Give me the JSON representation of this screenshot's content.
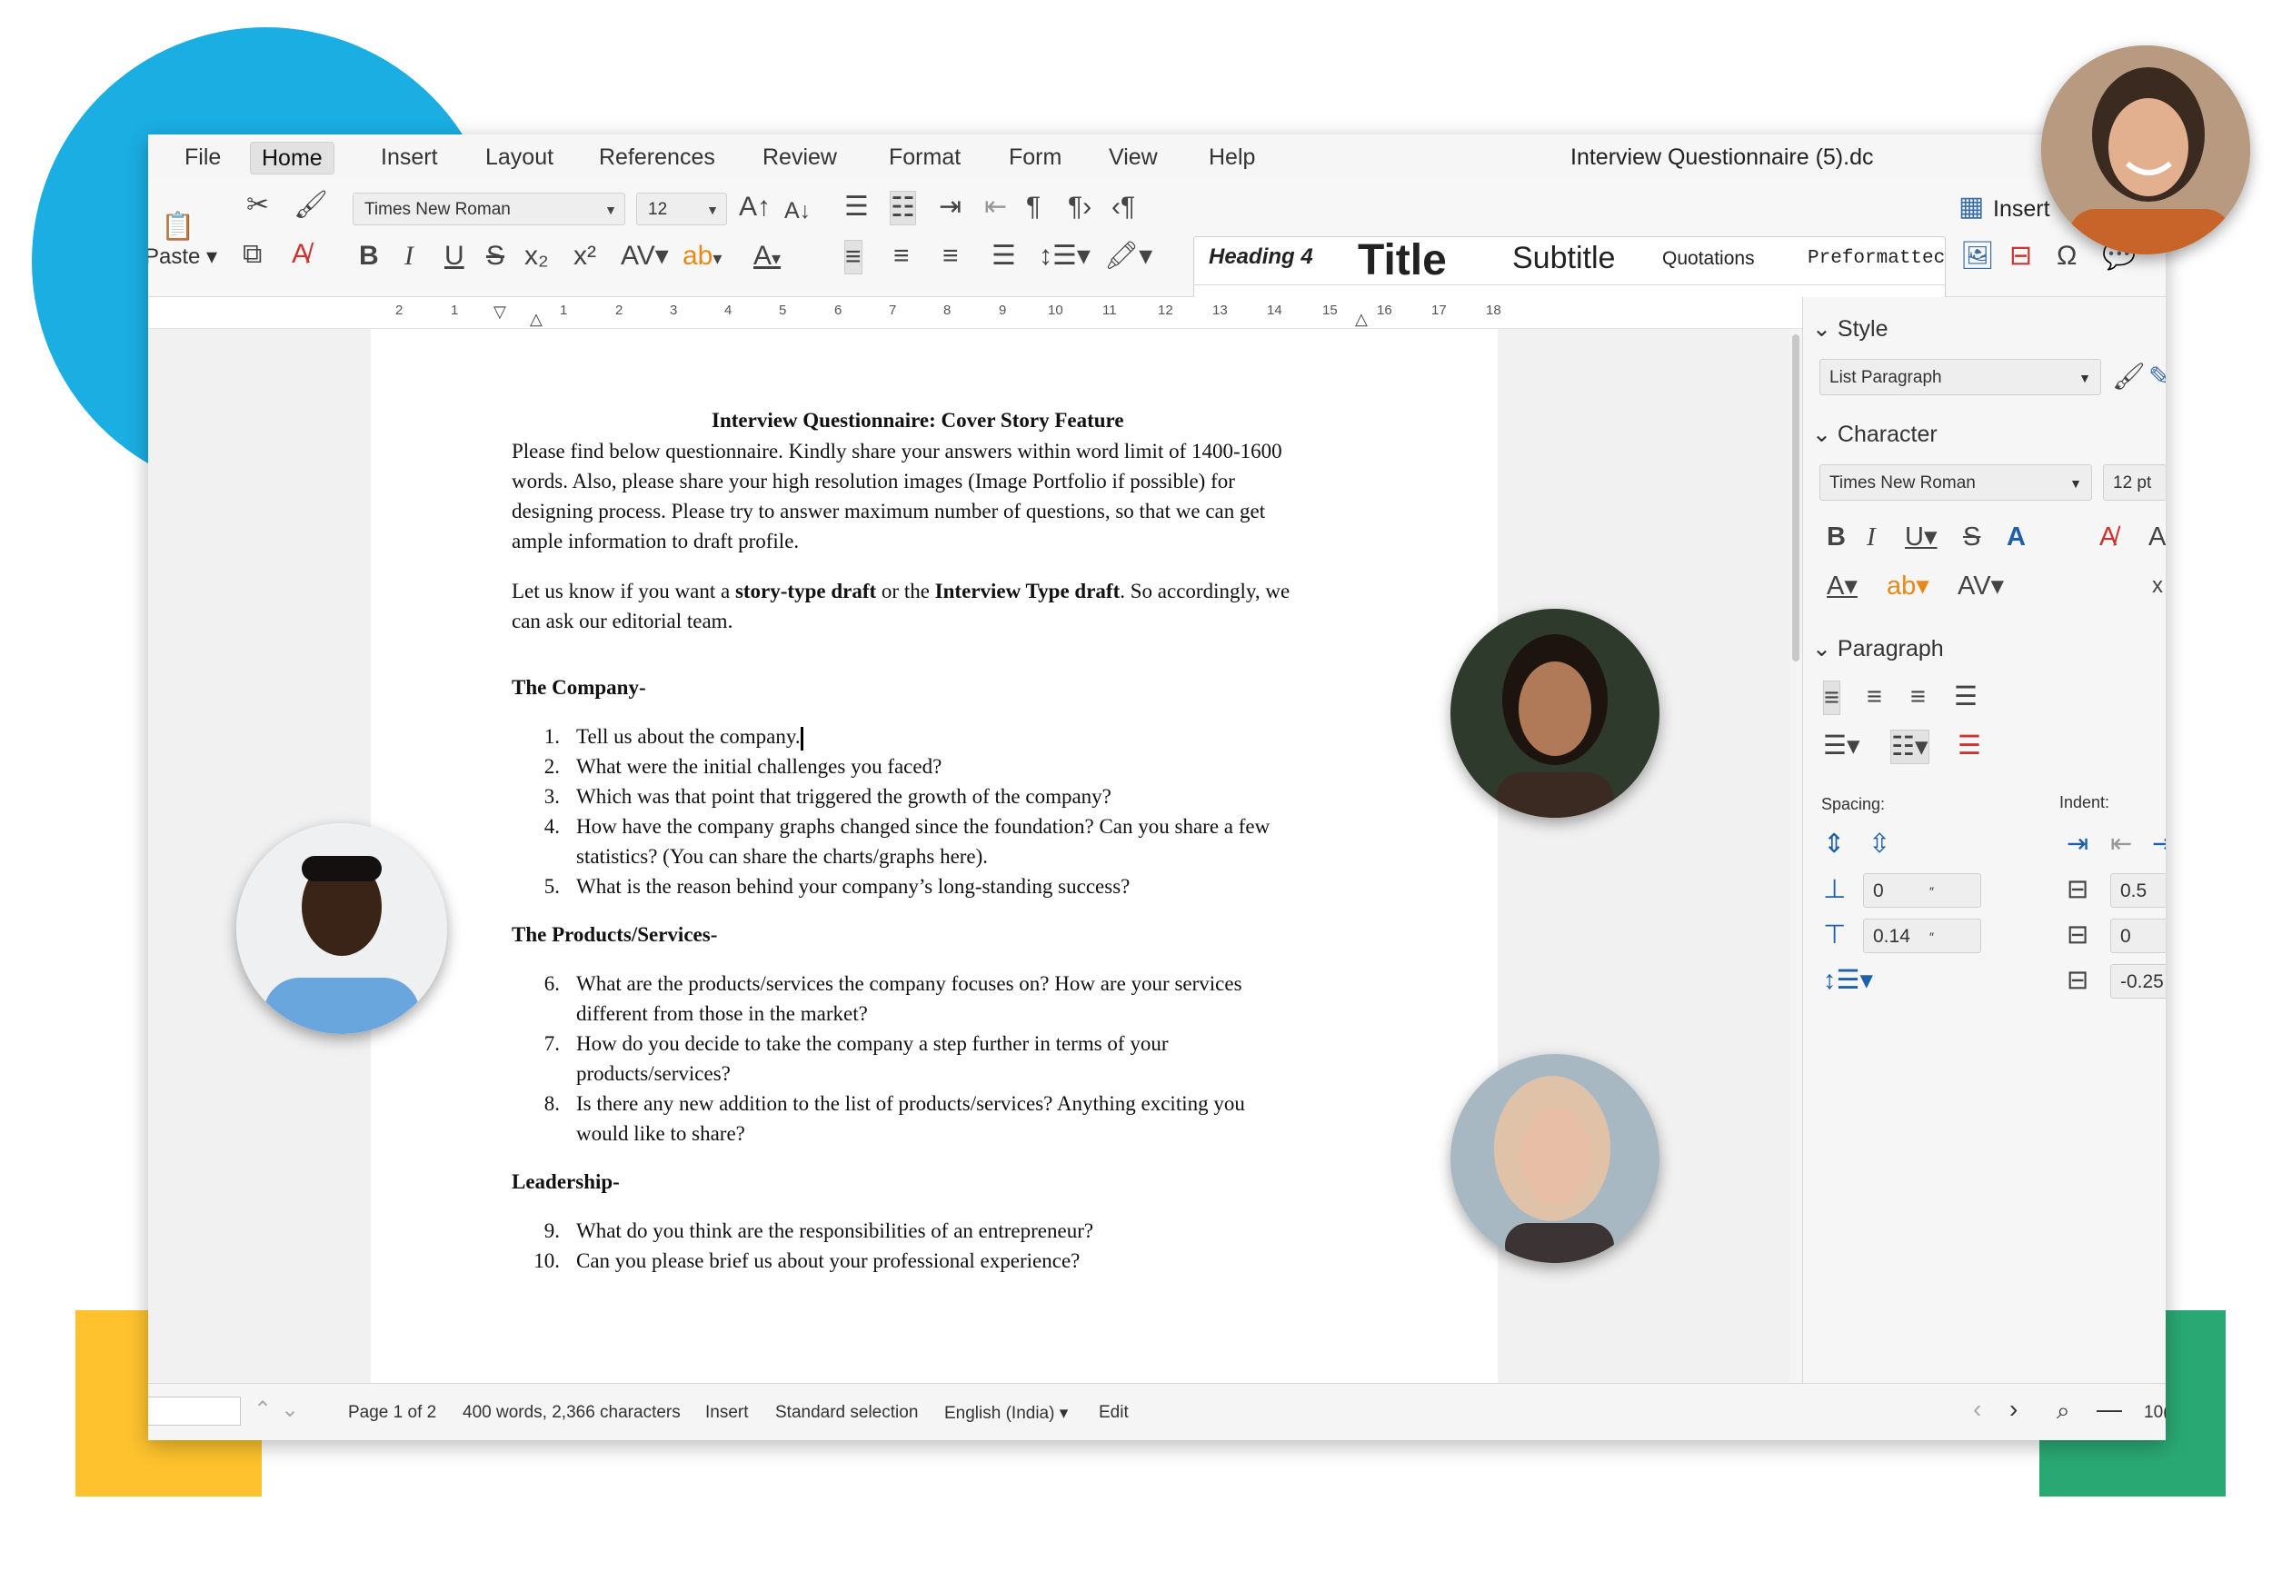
{
  "menubar": {
    "items": [
      "File",
      "Home",
      "Insert",
      "Layout",
      "References",
      "Review",
      "Format",
      "Form",
      "View",
      "Help"
    ],
    "active": "Home",
    "document_title": "Interview Questionnaire (5).dc"
  },
  "toolbar": {
    "paste_label": "Paste",
    "font_name": "Times New Roman",
    "font_size": "12",
    "style_gallery": {
      "heading4": "Heading 4",
      "title": "Title",
      "subtitle": "Subtitle",
      "quotations": "Quotations",
      "preformatted": "Preformattec",
      "current": "List Paragraph"
    },
    "insert_label": "Insert",
    "icons": [
      "paste-icon",
      "cut-icon",
      "copy-icon",
      "clone-formatting-icon",
      "clear-formatting-icon",
      "bold-icon",
      "italic-icon",
      "underline-icon",
      "strikethrough-icon",
      "subscript-icon",
      "superscript-icon",
      "character-spacing-icon",
      "highlight-icon",
      "font-color-icon",
      "grow-font-icon",
      "shrink-font-icon",
      "bullets-icon",
      "numbering-icon",
      "indent-icon",
      "outdent-icon",
      "pilcrow-icon",
      "ltr-icon",
      "rtl-icon",
      "align-left-icon",
      "align-center-icon",
      "align-right-icon",
      "justify-icon",
      "line-spacing-icon",
      "paragraph-background-icon",
      "table-icon",
      "image-icon",
      "page-break-icon",
      "special-character-icon",
      "comment-icon"
    ]
  },
  "ruler": {
    "numbers": [
      "2",
      "1",
      "1",
      "2",
      "3",
      "4",
      "5",
      "6",
      "7",
      "8",
      "9",
      "10",
      "11",
      "12",
      "13",
      "14",
      "15",
      "16",
      "17",
      "18"
    ]
  },
  "document": {
    "title": "Interview Questionnaire: Cover Story Feature",
    "intro_lines": [
      "Please find below questionnaire. Kindly share your answers within word limit of 1400-1600",
      "words. Also, please share your high resolution images (Image Portfolio if possible) for",
      "designing process. Please try to answer maximum number of questions, so that we can get",
      "ample information to draft profile."
    ],
    "choice_line1": {
      "a": "Let us know if you want a ",
      "b": "story-type draft",
      "c": " or the ",
      "d": "Interview Type draft",
      "e": ". So accordingly, we"
    },
    "choice_line2": "can ask our editorial team.",
    "sections": [
      {
        "heading": "The Company-",
        "items": [
          {
            "num": "1.",
            "lines": [
              "Tell us about the company."
            ]
          },
          {
            "num": "2.",
            "lines": [
              "What were the initial challenges you faced?"
            ]
          },
          {
            "num": "3.",
            "lines": [
              "Which was that point that triggered the growth of the company?"
            ]
          },
          {
            "num": "4.",
            "lines": [
              "How have the company graphs changed since the foundation? Can you share a few",
              "statistics? (You can share the charts/graphs here)."
            ]
          },
          {
            "num": "5.",
            "lines": [
              "What is the reason behind your company’s long-standing success?"
            ]
          }
        ]
      },
      {
        "heading": "The Products/Services-",
        "items": [
          {
            "num": "6.",
            "lines": [
              "What are the products/services the company focuses on? How are your services",
              "different from those in the market?"
            ]
          },
          {
            "num": "7.",
            "lines": [
              "How do you decide to take the company a step further in terms of your",
              "products/services?"
            ]
          },
          {
            "num": "8.",
            "lines": [
              " Is there any new addition to the list of products/services? Anything exciting you",
              "would like to share?"
            ]
          }
        ]
      },
      {
        "heading": "Leadership-",
        "items": [
          {
            "num": "9.",
            "lines": [
              "What do you think are the responsibilities of an entrepreneur?"
            ]
          },
          {
            "num": "10.",
            "lines": [
              "Can you please brief us about your professional experience?"
            ]
          }
        ]
      }
    ]
  },
  "sidebar": {
    "style_heading": "Style",
    "style_value": "List Paragraph",
    "character_heading": "Character",
    "font_value": "Times New Roman",
    "size_value": "12 pt",
    "paragraph_heading": "Paragraph",
    "spacing_label": "Spacing:",
    "indent_label": "Indent:",
    "spacing_above": "0",
    "spacing_below": "0.14",
    "spacing_unit": "″",
    "indent_before": "0.5",
    "indent_after": "0",
    "indent_first": "-0.25"
  },
  "statusbar": {
    "page": "Page 1 of 2",
    "counts": "400 words, 2,366 characters",
    "mode": "Insert",
    "selection": "Standard selection",
    "language": "English (India)",
    "edit": "Edit",
    "zoom": "10("
  },
  "colors": {
    "blue": "#1aaee3",
    "yellow": "#fdc22d",
    "green": "#2aa873"
  }
}
